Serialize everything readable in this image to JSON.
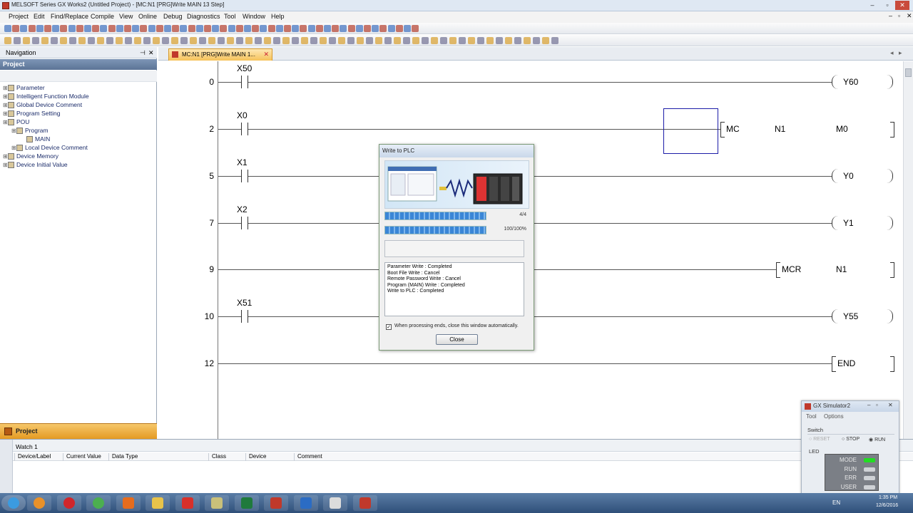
{
  "window": {
    "title": "MELSOFT Series GX Works2 (Untitled Project) - [MC:N1 [PRG]Write MAIN 13 Step]",
    "min": "▭",
    "restore": "▭",
    "close": "✕"
  },
  "menu": [
    "Project",
    "Edit",
    "Find/Replace",
    "Compile",
    "View",
    "Online",
    "Debug",
    "Diagnostics",
    "Tool",
    "Window",
    "Help"
  ],
  "navigation": {
    "title": "Navigation",
    "pin": "ᵃ",
    "close": "✕",
    "section": "Project",
    "tree": [
      {
        "label": "Parameter",
        "indent": 0
      },
      {
        "label": "Intelligent Function Module",
        "indent": 0
      },
      {
        "label": "Global Device Comment",
        "indent": 0
      },
      {
        "label": "Program Setting",
        "indent": 0
      },
      {
        "label": "POU",
        "indent": 0
      },
      {
        "label": "Program",
        "indent": 1
      },
      {
        "label": "MAIN",
        "indent": 2
      },
      {
        "label": "Local Device Comment",
        "indent": 1
      },
      {
        "label": "Device Memory",
        "indent": 0
      },
      {
        "label": "Device Initial Value",
        "indent": 0
      }
    ],
    "bottom_tab": "Project"
  },
  "tab": {
    "label": "MC:N1 [PRG]Write MAIN 1...",
    "close": "✕"
  },
  "ladder": {
    "rungs": [
      {
        "step": "0",
        "contact": "X50",
        "output": "Y60",
        "type": "coil"
      },
      {
        "step": "2",
        "contact": "X0",
        "output": "MC",
        "arg1": "N1",
        "arg2": "M0",
        "type": "instr"
      },
      {
        "step": "5",
        "contact": "X1",
        "output": "Y0",
        "type": "coil"
      },
      {
        "step": "7",
        "contact": "X2",
        "output": "Y1",
        "type": "coil"
      },
      {
        "step": "9",
        "contact": "",
        "output": "MCR",
        "arg1": "N1",
        "type": "instr"
      },
      {
        "step": "10",
        "contact": "X51",
        "output": "Y55",
        "type": "coil"
      },
      {
        "step": "12",
        "contact": "",
        "output": "END",
        "type": "end"
      }
    ]
  },
  "dialog": {
    "title": "Write to PLC",
    "progress1": {
      "label": "4/4",
      "value": 1.0
    },
    "progress2": {
      "label": "100/100%",
      "value": 1.0
    },
    "log": [
      "Parameter Write : Completed",
      "Boot File Write : Cancel",
      "Remote Password Write : Cancel",
      "Program (MAIN) Write : Completed",
      "Write to PLC : Completed"
    ],
    "checkbox": {
      "label": "When processing ends, close this window automatically.",
      "checked": true,
      "mark": "✓"
    },
    "close": "Close"
  },
  "watch": {
    "title": "Watch 1",
    "columns": [
      "Device/Label",
      "Current Value",
      "Data Type",
      "Class",
      "Device",
      "Comment"
    ]
  },
  "simulator": {
    "title": "GX Simulator2",
    "menu": [
      "Tool",
      "Options"
    ],
    "switch_label": "Switch",
    "switch_options": [
      "RESET",
      "STOP",
      "RUN"
    ],
    "selected": "RUN",
    "led_label": "LED",
    "leds": [
      {
        "name": "MODE",
        "color": "#22dd22"
      },
      {
        "name": "RUN",
        "color": "#cfd2d6"
      },
      {
        "name": "ERR",
        "color": "#cfd2d6"
      },
      {
        "name": "USER",
        "color": "#cfd2d6"
      }
    ]
  },
  "taskbar": {
    "clock_time": "1:35 PM",
    "clock_date": "12/6/2016",
    "lang": "EN",
    "icons": [
      "windows-start",
      "media-player",
      "opera",
      "chrome",
      "firefox",
      "file-explorer",
      "pdf-reader",
      "disc-tool",
      "excel",
      "gx-developer",
      "help",
      "window",
      "melsoft"
    ]
  }
}
